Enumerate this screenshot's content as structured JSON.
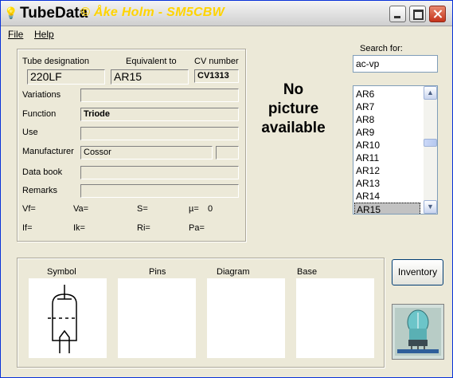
{
  "window": {
    "title": "TubeData",
    "subtitle": "© Åke Holm - SM5CBW"
  },
  "menu": [
    "File",
    "Help"
  ],
  "fields": {
    "tube_designation": {
      "label": "Tube designation",
      "value": "220LF"
    },
    "equivalent": {
      "label": "Equivalent to",
      "value": "AR15"
    },
    "cv_number": {
      "label": "CV number",
      "value": "CV1313"
    },
    "variations": {
      "label": "Variations",
      "value": ""
    },
    "function": {
      "label": "Function",
      "value": "Triode"
    },
    "use": {
      "label": "Use",
      "value": ""
    },
    "manufacturer": {
      "label": "Manufacturer",
      "value": "Cossor",
      "extra": ""
    },
    "data_book": {
      "label": "Data book",
      "value": ""
    },
    "remarks": {
      "label": "Remarks",
      "value": ""
    }
  },
  "params": {
    "vf": "Vf=",
    "va": "Va=",
    "s": "S=",
    "mu": "µ=",
    "mu_value": "0",
    "if": "If=",
    "ik": "Ik=",
    "ri": "Ri=",
    "pa": "Pa="
  },
  "picture_placeholder": {
    "line1": "No",
    "line2": "picture",
    "line3": "available"
  },
  "search": {
    "label": "Search for:",
    "value": "ac-vp"
  },
  "list": {
    "items": [
      "AR6",
      "AR7",
      "AR8",
      "AR9",
      "AR10",
      "AR11",
      "AR12",
      "AR13",
      "AR14",
      "AR15"
    ],
    "selected": "AR15"
  },
  "graphics": {
    "symbol": "Symbol",
    "pins": "Pins",
    "diagram": "Diagram",
    "base": "Base"
  },
  "buttons": {
    "inventory": "Inventory"
  },
  "colors": {
    "subtitle": "#ffd400",
    "selection": "#c2c2c2"
  }
}
